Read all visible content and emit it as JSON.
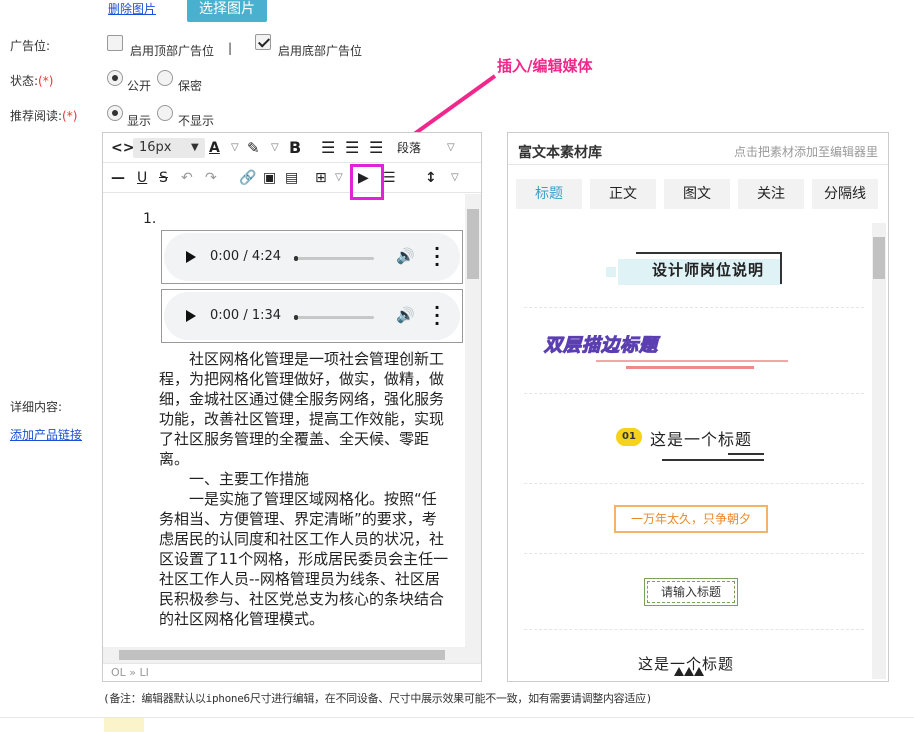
{
  "top": {
    "delete_image": "删除图片",
    "choose_image": "选择图片"
  },
  "ad": {
    "label": "广告位:",
    "top_ad": "启用顶部广告位",
    "separator": "|",
    "bottom_ad": "启用底部广告位",
    "top_checked": false,
    "bottom_checked": true
  },
  "status": {
    "label": "状态:",
    "required": "(*)",
    "option1": "公开",
    "option2": "保密",
    "selected": "公开"
  },
  "recommend": {
    "label": "推荐阅读:",
    "required": "(*)",
    "option1": "显示",
    "option2": "不显示",
    "selected": "显示"
  },
  "detail": {
    "label": "详细内容:",
    "add_link": "添加产品链接"
  },
  "annotation": "插入/编辑媒体",
  "toolbar": {
    "code_icon": "<>",
    "font_size": "16px",
    "font_color_icon": "A",
    "bold_icon": "B",
    "paragraph_label": "段落",
    "highlight_color": "#e023d6"
  },
  "editor": {
    "list_number": "1.",
    "audio": [
      {
        "time": "0:00 / 4:24"
      },
      {
        "time": "0:00 / 1:34"
      }
    ],
    "paragraphs": [
      "　　社区网格化管理是一项社会管理创新工程，为把网格化管理做好，做实，做精，做细，金城社区通过健全服务网络，强化服务功能，改善社区管理，提高工作效能，实现了社区服务管理的全覆盖、全天候、零距离。",
      "　　一、主要工作措施",
      "　　一是实施了管理区域网格化。按照“任务相当、方便管理、界定清晰”的要求，考虑居民的认同度和社区工作人员的状况，社区设置了11个网格，形成居民委员会主任一社区工作人员--网格管理员为线条、社区居民积极参与、社区党总支为核心的条块结合的社区网格化管理模式。"
    ],
    "status_path": "OL » LI"
  },
  "library": {
    "title": "富文本素材库",
    "tip": "点击把素材添加至编辑器里",
    "tabs": [
      "标题",
      "正文",
      "图文",
      "关注",
      "分隔线"
    ],
    "active_tab": "标题",
    "samples": {
      "s1": "设计师岗位说明",
      "s2": "双层描边标题",
      "s3_badge": "01",
      "s3_text": "这是一个标题",
      "s4": "一万年太久，只争朝夕",
      "s5": "请输入标题",
      "s6": "这是一个标题"
    }
  },
  "note": "(备注：编辑器默认以iphone6尺寸进行编辑，在不同设备、尺寸中展示效果可能不一致，如有需要请调整内容适应)",
  "colors": {
    "accent": "#4ab0cf",
    "annotation": "#f0288c",
    "active_tab": "#3aa0c8",
    "link": "#1a4fd6"
  }
}
